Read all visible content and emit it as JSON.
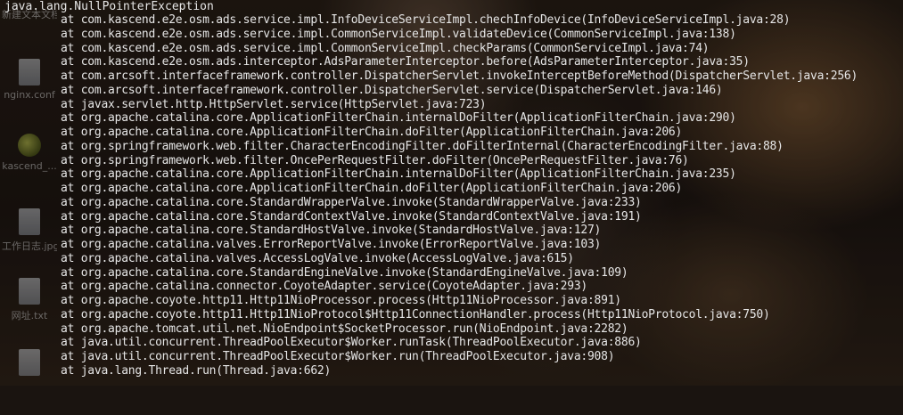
{
  "desktop": {
    "icons": [
      {
        "label": "新建文本文档.txt",
        "icon": "text-file-icon"
      },
      {
        "label": "nginx.conf",
        "icon": "text-file-icon"
      },
      {
        "label": "kascend_...",
        "icon": "executable-icon"
      },
      {
        "label": "工作日志.jpg",
        "icon": "image-file-icon"
      },
      {
        "label": "网址.txt",
        "icon": "text-file-icon"
      },
      {
        "label": "",
        "icon": "text-file-icon"
      }
    ]
  },
  "console": {
    "exception": "java.lang.NullPointerException",
    "frames": [
      "at com.kascend.e2e.osm.ads.service.impl.InfoDeviceServiceImpl.chechInfoDevice(InfoDeviceServiceImpl.java:28)",
      "at com.kascend.e2e.osm.ads.service.impl.CommonServiceImpl.validateDevice(CommonServiceImpl.java:138)",
      "at com.kascend.e2e.osm.ads.service.impl.CommonServiceImpl.checkParams(CommonServiceImpl.java:74)",
      "at com.kascend.e2e.osm.ads.interceptor.AdsParameterInterceptor.before(AdsParameterInterceptor.java:35)",
      "at com.arcsoft.interfaceframework.controller.DispatcherServlet.invokeInterceptBeforeMethod(DispatcherServlet.java:256)",
      "at com.arcsoft.interfaceframework.controller.DispatcherServlet.service(DispatcherServlet.java:146)",
      "at javax.servlet.http.HttpServlet.service(HttpServlet.java:723)",
      "at org.apache.catalina.core.ApplicationFilterChain.internalDoFilter(ApplicationFilterChain.java:290)",
      "at org.apache.catalina.core.ApplicationFilterChain.doFilter(ApplicationFilterChain.java:206)",
      "at org.springframework.web.filter.CharacterEncodingFilter.doFilterInternal(CharacterEncodingFilter.java:88)",
      "at org.springframework.web.filter.OncePerRequestFilter.doFilter(OncePerRequestFilter.java:76)",
      "at org.apache.catalina.core.ApplicationFilterChain.internalDoFilter(ApplicationFilterChain.java:235)",
      "at org.apache.catalina.core.ApplicationFilterChain.doFilter(ApplicationFilterChain.java:206)",
      "at org.apache.catalina.core.StandardWrapperValve.invoke(StandardWrapperValve.java:233)",
      "at org.apache.catalina.core.StandardContextValve.invoke(StandardContextValve.java:191)",
      "at org.apache.catalina.core.StandardHostValve.invoke(StandardHostValve.java:127)",
      "at org.apache.catalina.valves.ErrorReportValve.invoke(ErrorReportValve.java:103)",
      "at org.apache.catalina.valves.AccessLogValve.invoke(AccessLogValve.java:615)",
      "at org.apache.catalina.core.StandardEngineValve.invoke(StandardEngineValve.java:109)",
      "at org.apache.catalina.connector.CoyoteAdapter.service(CoyoteAdapter.java:293)",
      "at org.apache.coyote.http11.Http11NioProcessor.process(Http11NioProcessor.java:891)",
      "at org.apache.coyote.http11.Http11NioProtocol$Http11ConnectionHandler.process(Http11NioProtocol.java:750)",
      "at org.apache.tomcat.util.net.NioEndpoint$SocketProcessor.run(NioEndpoint.java:2282)",
      "at java.util.concurrent.ThreadPoolExecutor$Worker.runTask(ThreadPoolExecutor.java:886)",
      "at java.util.concurrent.ThreadPoolExecutor$Worker.run(ThreadPoolExecutor.java:908)",
      "at java.lang.Thread.run(Thread.java:662)"
    ]
  },
  "colors": {
    "text": "#e6e6e6",
    "background": "#1a1410"
  }
}
